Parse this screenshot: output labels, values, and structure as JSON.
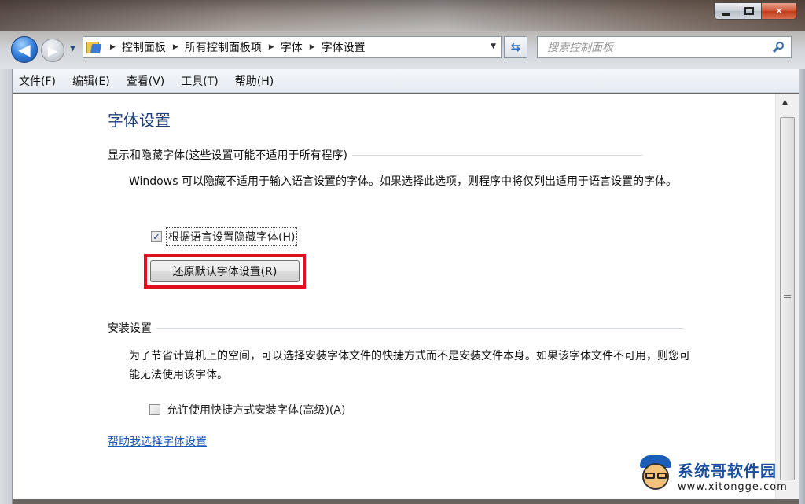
{
  "window": {
    "caption_buttons": {
      "minimize_icon": "minimize-icon",
      "maximize_icon": "maximize-icon",
      "close_glyph": "✕"
    }
  },
  "nav": {
    "back_glyph": "◀",
    "forward_glyph": "▶",
    "breadcrumbs": [
      "控制面板",
      "所有控制面板项",
      "字体",
      "字体设置"
    ],
    "search_placeholder": "搜索控制面板"
  },
  "menu": [
    "文件(F)",
    "编辑(E)",
    "查看(V)",
    "工具(T)",
    "帮助(H)"
  ],
  "content": {
    "title": "字体设置",
    "section1": {
      "heading": "显示和隐藏字体(这些设置可能不适用于所有程序)",
      "description": "Windows 可以隐藏不适用于输入语言设置的字体。如果选择此选项，则程序中将仅列出适用于语言设置的字体。",
      "checkbox_label": "根据语言设置隐藏字体(H)",
      "checkbox_checked": true,
      "button_label": "还原默认字体设置(R)",
      "highlight_color": "#e0101e"
    },
    "section2": {
      "heading": "安装设置",
      "description": "为了节省计算机上的空间，可以选择安装字体文件的快捷方式而不是安装文件本身。如果该字体文件不可用，则您可能无法使用该字体。",
      "checkbox_label": "允许使用快捷方式安装字体(高级)(A)",
      "checkbox_checked": false
    },
    "help_link": "帮助我选择字体设置"
  },
  "watermark": {
    "title": "系统哥软件园",
    "url": "www.xitongge.com"
  }
}
